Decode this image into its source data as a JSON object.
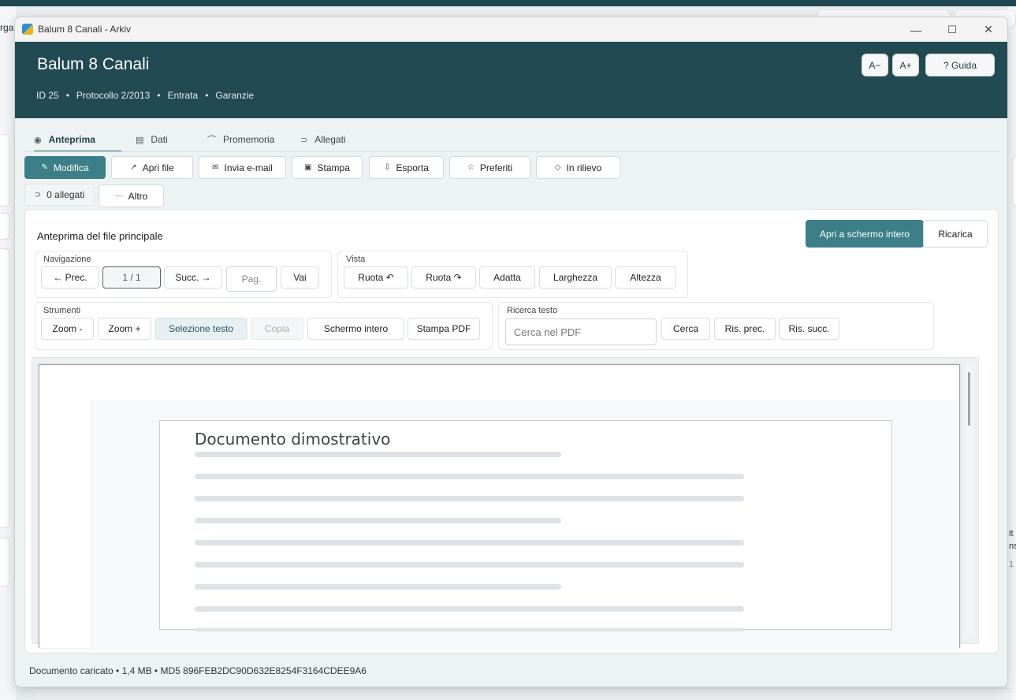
{
  "background": {
    "left_fragment": "rga",
    "right_fragments": [
      "it",
      "nsi",
      "1"
    ]
  },
  "window": {
    "title": "Balum 8 Canali - Arkiv",
    "controls": {
      "minimize": "—",
      "maximize": "☐",
      "close": "✕"
    }
  },
  "header": {
    "title": "Balum 8 Canali",
    "meta": [
      "ID 25",
      "Protocollo 2/2013",
      "Entrata",
      "Garanzie"
    ],
    "meta_sep": "•",
    "font_smaller": "A−",
    "font_larger": "A+",
    "help": "? Guida"
  },
  "tabs": [
    {
      "label": "Anteprima",
      "icon": "eye-icon",
      "glyph": "◉",
      "active": true
    },
    {
      "label": "Dati",
      "icon": "document-icon",
      "glyph": "▤",
      "active": false
    },
    {
      "label": "Promemoria",
      "icon": "bell-icon",
      "glyph": "⌒",
      "active": false
    },
    {
      "label": "Allegati",
      "icon": "paperclip-icon",
      "glyph": "⊃",
      "active": false
    }
  ],
  "actions": {
    "edit": {
      "label": "Modifica",
      "glyph": "✎"
    },
    "open_file": {
      "label": "Apri file",
      "glyph": "↗"
    },
    "send_email": {
      "label": "Invia e-mail",
      "glyph": "✉"
    },
    "print": {
      "label": "Stampa",
      "glyph": "▣"
    },
    "export": {
      "label": "Esporta",
      "glyph": "⇩"
    },
    "favorites": {
      "label": "Preferiti",
      "glyph": "☆"
    },
    "highlight": {
      "label": "In rilievo",
      "glyph": "◇"
    },
    "attachments": {
      "label": "0 allegati",
      "glyph": "⊃"
    },
    "more": {
      "label": "Altro",
      "glyph": "···"
    }
  },
  "preview": {
    "title": "Anteprima del file principale",
    "open_fullscreen": "Apri a schermo intero",
    "reload": "Ricarica",
    "navigation": {
      "label": "Navigazione",
      "prev": "← Prec.",
      "page_value": "1 / 1",
      "next": "Succ. →",
      "page_placeholder": "Pag.",
      "go": "Vai"
    },
    "view": {
      "label": "Vista",
      "rotate_left": "Ruota ↶",
      "rotate_right": "Ruota ↷",
      "fit": "Adatta",
      "width": "Larghezza",
      "height": "Altezza"
    },
    "tools": {
      "label": "Strumenti",
      "zoom_out": "Zoom -",
      "zoom_in": "Zoom +",
      "select_text": "Selezione testo",
      "copy": "Copia",
      "fullscreen": "Schermo intero",
      "print_pdf": "Stampa PDF"
    },
    "search": {
      "label": "Ricerca testo",
      "placeholder": "Cerca nel PDF",
      "search": "Cerca",
      "prev_result": "Ris. prec.",
      "next_result": "Ris. succ."
    },
    "document": {
      "title": "Documento dimostrativo"
    }
  },
  "status": "Documento caricato • 1,4 MB • MD5 896FEB2DC90D632E8254F3164CDEE9A6"
}
